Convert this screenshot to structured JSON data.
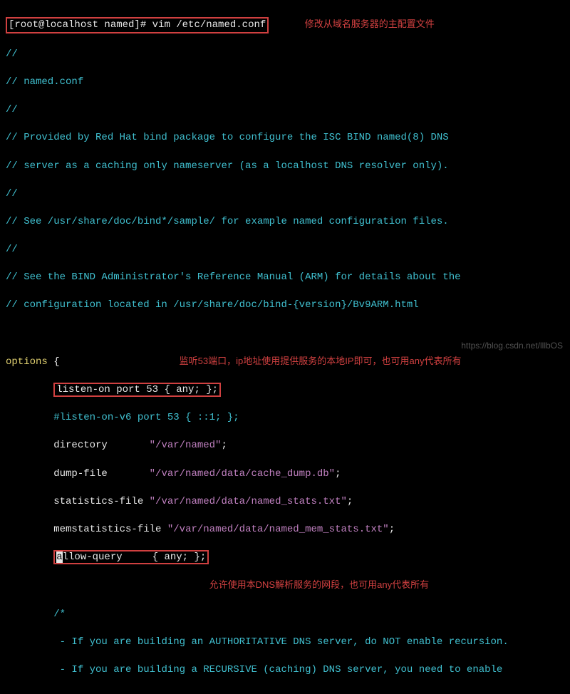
{
  "prompt": {
    "user_host": "[root@localhost named]#",
    "command": "vim /etc/named.conf"
  },
  "annotations": {
    "top": "修改从域名服务器的主配置文件",
    "listen": "监听53端口，ip地址使用提供服务的本地IP即可，也可用any代表所有",
    "allow": "允许使用本DNS解析服务的网段，也可用any代表所有"
  },
  "file": {
    "c1": "//",
    "c2": "// named.conf",
    "c3": "//",
    "c4": "// Provided by Red Hat bind package to configure the ISC BIND named(8) DNS",
    "c5": "// server as a caching only nameserver (as a localhost DNS resolver only).",
    "c6": "//",
    "c7": "// See /usr/share/doc/bind*/sample/ for example named configuration files.",
    "c8": "//",
    "c9": "// See the BIND Administrator's Reference Manual (ARM) for details about the",
    "c10": "// configuration located in /usr/share/doc/bind-{version}/Bv9ARM.html",
    "options_kw": "options ",
    "brace_open": "{",
    "listen_on": "listen-on port 53 { any; };",
    "listen_v6": "#listen-on-v6 port 53 { ::1; };",
    "dir_key": "directory       ",
    "dir_val": "\"/var/named\"",
    "semi": ";",
    "dump_key": "dump-file       ",
    "dump_val": "\"/var/named/data/cache_dump.db\"",
    "stats_key": "statistics-file ",
    "stats_val": "\"/var/named/data/named_stats.txt\"",
    "mem_key": "memstatistics-file ",
    "mem_val": "\"/var/named/data/named_mem_stats.txt\"",
    "allow_cursor": "a",
    "allow_rest": "llow-query     { any; };",
    "cm_open": "/*",
    "cm_l1": " - If you are building an AUTHORITATIVE DNS server, do NOT enable recursion.",
    "cm_l2": " - If you are building a RECURSIVE (caching) DNS server, you need to enable"
  },
  "watermark": "https://blog.csdn.net/lllbOS"
}
